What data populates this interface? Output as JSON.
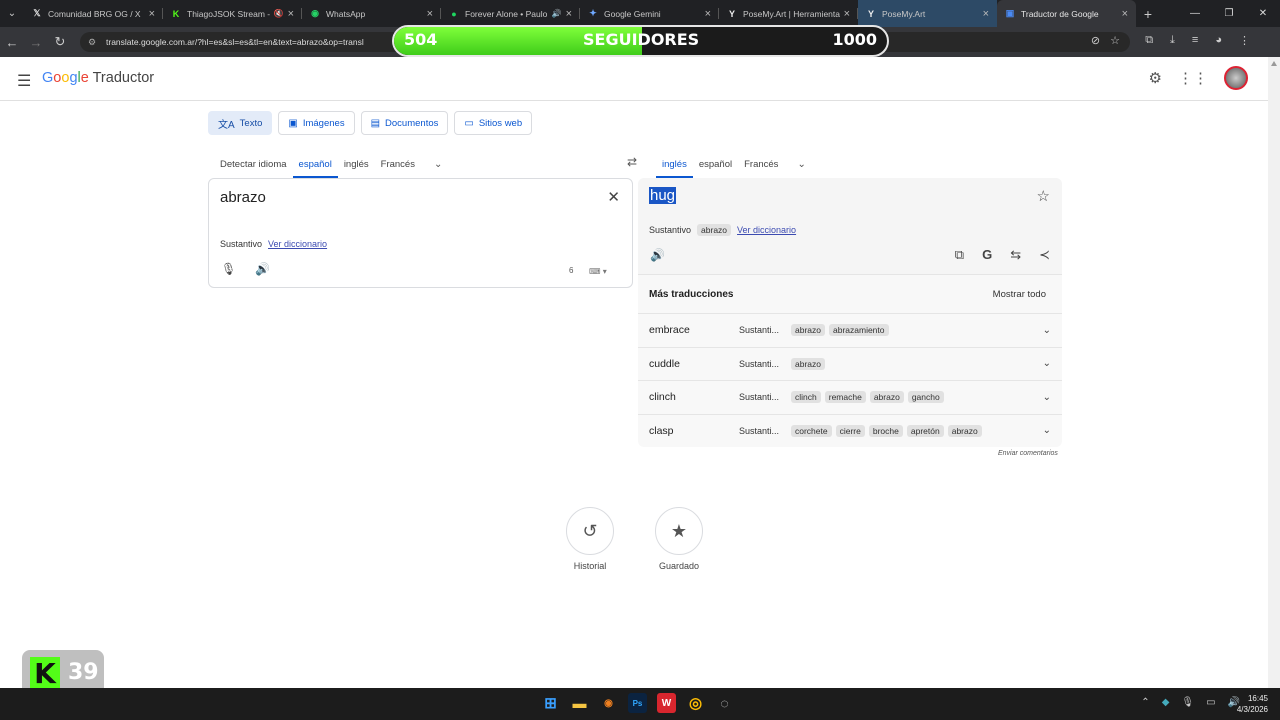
{
  "browser": {
    "tabs": [
      {
        "title": "Comunidad BRG OG / X",
        "icon": "x-logo-icon",
        "glyph": "𝕏",
        "color": "#ddd"
      },
      {
        "title": "ThiagoJSOK Stream -",
        "icon": "kick-icon",
        "glyph": "K",
        "color": "#53fc18"
      },
      {
        "title": "WhatsApp",
        "icon": "whatsapp-icon",
        "glyph": "◉",
        "color": "#25d366"
      },
      {
        "title": "Forever Alone • Paulo",
        "icon": "spotify-icon",
        "glyph": "●",
        "color": "#1ed760"
      },
      {
        "title": "Google Gemini",
        "icon": "gemini-icon",
        "glyph": "✦",
        "color": "#6fa8ff"
      },
      {
        "title": "PoseMy.Art | Herramienta",
        "icon": "posemyart-icon",
        "glyph": "Y",
        "color": "#eee"
      },
      {
        "title": "PoseMy.Art",
        "icon": "posemyart-icon",
        "glyph": "Y",
        "color": "#eee"
      },
      {
        "title": "Traductor de Google",
        "icon": "google-translate-icon",
        "glyph": "▣",
        "color": "#4a8af4"
      }
    ],
    "url": "translate.google.com.ar/?hl=es&sl=es&tl=en&text=abrazo&op=transl"
  },
  "overlay": {
    "followers_current": "504",
    "followers_label": "SEGUIDORES",
    "followers_goal": "1000",
    "progress": 0.504,
    "kick_badge": "39"
  },
  "header": {
    "logo_google": "Google",
    "logo_product": "Traductor"
  },
  "modes": [
    {
      "label": "Texto",
      "icon": "translate-icon",
      "glyph": "文A"
    },
    {
      "label": "Imágenes",
      "icon": "image-icon",
      "glyph": "▣"
    },
    {
      "label": "Documentos",
      "icon": "document-icon",
      "glyph": "▤"
    },
    {
      "label": "Sitios web",
      "icon": "website-icon",
      "glyph": "▭"
    }
  ],
  "source": {
    "languages": [
      "Detectar idioma",
      "español",
      "inglés",
      "Francés"
    ],
    "text": "abrazo",
    "pos": "Sustantivo",
    "dict_link": "Ver diccionario",
    "char_count": "6"
  },
  "target": {
    "languages": [
      "inglés",
      "español",
      "Francés"
    ],
    "text": "hug",
    "pos": "Sustantivo",
    "pos_chip": "abrazo",
    "dict_link": "Ver diccionario"
  },
  "more": {
    "title": "Más traducciones",
    "show_all": "Mostrar todo",
    "rows": [
      {
        "word": "embrace",
        "pos": "Sustanti...",
        "chips": [
          "abrazo",
          "abrazamiento"
        ]
      },
      {
        "word": "cuddle",
        "pos": "Sustanti...",
        "chips": [
          "abrazo"
        ]
      },
      {
        "word": "clinch",
        "pos": "Sustanti...",
        "chips": [
          "clinch",
          "remache",
          "abrazo",
          "gancho"
        ]
      },
      {
        "word": "clasp",
        "pos": "Sustanti...",
        "chips": [
          "corchete",
          "cierre",
          "broche",
          "apretón",
          "abrazo"
        ]
      }
    ]
  },
  "feedback": "Enviar comentarios",
  "bottom": {
    "history": "Historial",
    "saved": "Guardado"
  },
  "taskbar": {
    "time": "16:45",
    "date": "4/3/2026"
  }
}
